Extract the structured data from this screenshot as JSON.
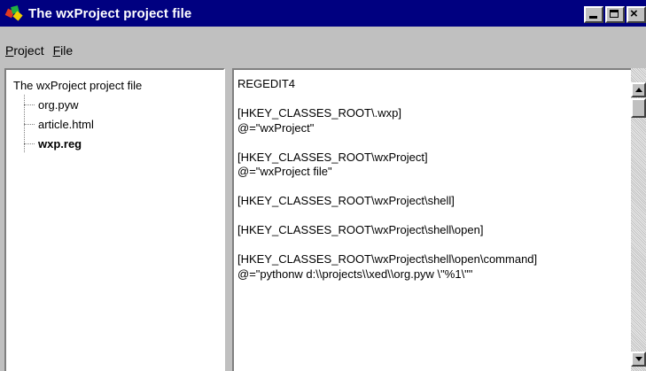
{
  "window": {
    "title": "The wxProject project file",
    "icon": "wxproject-app-icon",
    "title_bar_color": "#000080"
  },
  "menu": {
    "items": [
      {
        "label": "Project"
      },
      {
        "label": "File"
      }
    ]
  },
  "tree": {
    "root": "The wxProject project file",
    "children": [
      {
        "label": "org.pyw",
        "selected": false
      },
      {
        "label": "article.html",
        "selected": false
      },
      {
        "label": "wxp.reg",
        "selected": true
      }
    ]
  },
  "editor": {
    "lines": [
      "REGEDIT4",
      "",
      "[HKEY_CLASSES_ROOT\\.wxp]",
      "@=\"wxProject\"",
      "",
      "[HKEY_CLASSES_ROOT\\wxProject]",
      "@=\"wxProject file\"",
      "",
      "[HKEY_CLASSES_ROOT\\wxProject\\shell]",
      "",
      "[HKEY_CLASSES_ROOT\\wxProject\\shell\\open]",
      "",
      "[HKEY_CLASSES_ROOT\\wxProject\\shell\\open\\command]",
      "@=\"pythonw d:\\\\projects\\\\xed\\\\org.pyw \\\"%1\\\"\""
    ]
  }
}
